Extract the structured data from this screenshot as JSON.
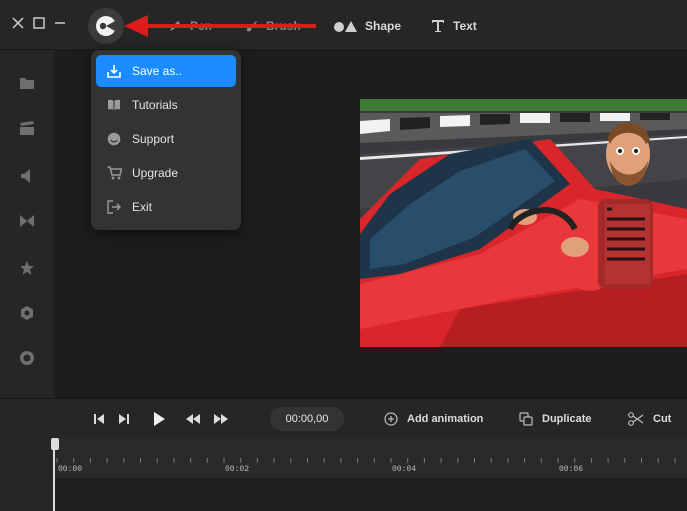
{
  "toolbar": {
    "tools": [
      {
        "label": "Pen",
        "icon": "pen-icon"
      },
      {
        "label": "Brush",
        "icon": "brush-icon"
      },
      {
        "label": "Shape",
        "icon": "shape-icon"
      },
      {
        "label": "Text",
        "icon": "text-icon"
      }
    ]
  },
  "menu": {
    "items": [
      {
        "label": "Save as..",
        "icon": "save-icon",
        "active": true
      },
      {
        "label": "Tutorials",
        "icon": "book-icon"
      },
      {
        "label": "Support",
        "icon": "smile-icon"
      },
      {
        "label": "Upgrade",
        "icon": "cart-icon"
      },
      {
        "label": "Exit",
        "icon": "exit-icon"
      }
    ]
  },
  "sidebar": {
    "items": [
      {
        "icon": "folder-icon"
      },
      {
        "icon": "clapperboard-icon"
      },
      {
        "icon": "speaker-icon"
      },
      {
        "icon": "transition-icon"
      },
      {
        "icon": "star-icon"
      },
      {
        "icon": "hexagon-icon"
      },
      {
        "icon": "record-icon"
      }
    ]
  },
  "playback": {
    "timecode": "00:00,00"
  },
  "actions": {
    "add_animation": "Add animation",
    "duplicate": "Duplicate",
    "cut": "Cut"
  },
  "timeline": {
    "ticks": [
      "00:00",
      "00:02",
      "00:04",
      "00:06"
    ]
  },
  "colors": {
    "accent": "#1a8cff",
    "annotation_arrow": "#e01b1b",
    "background": "#1f1f1f",
    "panel": "#262626"
  }
}
